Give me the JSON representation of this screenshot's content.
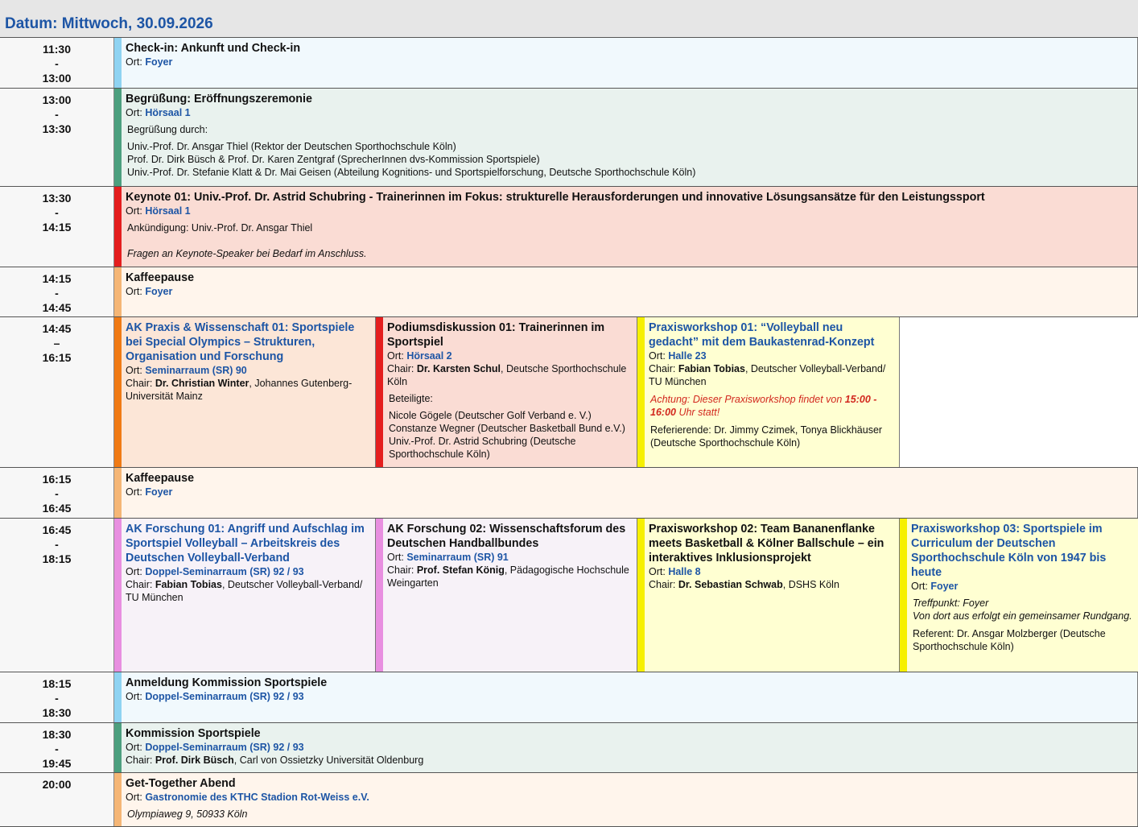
{
  "header": {
    "title": "Datum: Mittwoch, 30.09.2026"
  },
  "rows": [
    {
      "start": "11:30",
      "sep": "-",
      "end": "13:00",
      "cell": {
        "title": "Check-in: Ankunft und Check-in",
        "ort_label": "Ort:",
        "ort": "Foyer"
      }
    },
    {
      "start": "13:00",
      "sep": "-",
      "end": "13:30",
      "cell": {
        "title": "Begrüßung: Eröffnungszeremonie",
        "ort_label": "Ort:",
        "ort": "Hörsaal 1",
        "intro": "Begrüßung durch:",
        "lines": [
          "Univ.-Prof. Dr. Ansgar Thiel (Rektor der Deutschen Sporthochschule Köln)",
          "Prof. Dr. Dirk Büsch & Prof. Dr. Karen Zentgraf (SprecherInnen dvs-Kommission Sportspiele)",
          "Univ.-Prof. Dr. Stefanie Klatt & Dr. Mai Geisen (Abteilung Kognitions- und Sportspielforschung, Deutsche Sporthochschule Köln)"
        ]
      }
    },
    {
      "start": "13:30",
      "sep": "-",
      "end": "14:15",
      "cell": {
        "title": "Keynote 01: Univ.-Prof. Dr. Astrid Schubring - Trainerinnen im Fokus: strukturelle Herausforderungen und innovative Lösungsansätze für den Leistungssport",
        "ort_label": "Ort:",
        "ort": "Hörsaal 1",
        "announce": "Ankündigung: Univ.-Prof. Dr. Ansgar Thiel",
        "note": "Fragen an Keynote-Speaker bei Bedarf im Anschluss."
      }
    },
    {
      "start": "14:15",
      "sep": "-",
      "end": "14:45",
      "cell": {
        "title": "Kaffeepause",
        "ort_label": "Ort:",
        "ort": "Foyer"
      }
    },
    {
      "start": "14:45",
      "sep": "–",
      "end": "16:15",
      "cells": [
        {
          "title": "AK Praxis & Wissenschaft 01: Sportspiele bei Special Olympics – Strukturen, Organisation und Forschung",
          "ort_label": "Ort:",
          "ort": "Seminarraum (SR) 90",
          "chair_label": "Chair:",
          "chair_name": "Dr. Christian Winter",
          "chair_rest": ", Johannes Gutenberg-Universität Mainz"
        },
        {
          "title": "Podiumsdiskussion 01: Trainerinnen im Sportspiel",
          "ort_label": "Ort:",
          "ort": "Hörsaal 2",
          "chair_label": "Chair:",
          "chair_name": "Dr. Karsten Schul",
          "chair_rest": ", Deutsche Sporthochschule Köln",
          "intro": "Beteiligte:",
          "lines": [
            "Nicole Gögele (Deutscher Golf Verband e. V.)",
            "Constanze Wegner (Deutscher Basketball Bund e.V.)",
            "Univ.-Prof. Dr. Astrid Schubring (Deutsche Sporthochschule Köln)"
          ]
        },
        {
          "title": "Praxisworkshop 01: “Volleyball neu gedacht” mit dem Baukastenrad-Konzept",
          "ort_label": "Ort:",
          "ort": "Halle 23",
          "chair_label": "Chair:",
          "chair_name": "Fabian Tobias",
          "chair_rest": ", Deutscher Volleyball-Verband/ TU München",
          "warn_pre": "Achtung: Dieser Praxisworkshop findet von ",
          "warn_time": "15:00 - 16:00",
          "warn_post": " Uhr statt!",
          "ref": "Referierende: Dr. Jimmy Czimek, Tonya Blickhäuser (Deutsche Sporthochschule Köln)"
        }
      ]
    },
    {
      "start": "16:15",
      "sep": "-",
      "end": "16:45",
      "cell": {
        "title": "Kaffeepause",
        "ort_label": "Ort:",
        "ort": "Foyer"
      }
    },
    {
      "start": "16:45",
      "sep": "-",
      "end": "18:15",
      "cells": [
        {
          "title": "AK Forschung 01: Angriff und Aufschlag im Sportspiel Volleyball – Arbeitskreis des Deutschen Volleyball-Verband",
          "ort_label": "Ort:",
          "ort": "Doppel-Seminarraum (SR) 92 / 93",
          "chair_label": "Chair:",
          "chair_name": "Fabian Tobias",
          "chair_rest": ", Deutscher Volleyball-Verband/ TU München"
        },
        {
          "title": "AK Forschung 02: Wissenschaftsforum des Deutschen Handballbundes",
          "ort_label": "Ort:",
          "ort": "Seminarraum (SR) 91",
          "chair_label": "Chair:",
          "chair_name": "Prof. Stefan König",
          "chair_rest": ", Pädagogische Hochschule Weingarten"
        },
        {
          "title": "Praxisworkshop 02: Team Bananenflanke meets Basketball & Kölner Ballschule – ein interaktives Inklusionsprojekt",
          "ort_label": "Ort:",
          "ort": "Halle 8",
          "chair_label": "Chair:",
          "chair_name": "Dr. Sebastian Schwab",
          "chair_rest": ", DSHS Köln"
        },
        {
          "title": "Praxisworkshop 03: Sportspiele im Curriculum der Deutschen Sporthochschule Köln von 1947 bis heute",
          "ort_label": "Ort:",
          "ort": "Foyer",
          "note1": "Treffpunkt: Foyer",
          "note2": "Von dort aus erfolgt ein gemeinsamer Rundgang.",
          "ref": "Referent: Dr. Ansgar Molzberger (Deutsche Sporthochschule Köln)"
        }
      ]
    },
    {
      "start": "18:15",
      "sep": "-",
      "end": "18:30",
      "cell": {
        "title": "Anmeldung Kommission Sportspiele",
        "ort_label": "Ort:",
        "ort": "Doppel-Seminarraum (SR) 92 / 93"
      }
    },
    {
      "start": "18:30",
      "sep": "-",
      "end": "19:45",
      "cell": {
        "title": "Kommission Sportspiele",
        "ort_label": "Ort:",
        "ort": "Doppel-Seminarraum (SR) 92 / 93",
        "chair_label": "Chair:",
        "chair_name": "Prof. Dirk Büsch",
        "chair_rest": ", Carl von Ossietzky Universität Oldenburg"
      }
    },
    {
      "start": "20:00",
      "cell": {
        "title": "Get-Together Abend",
        "ort_label": "Ort:",
        "ort": "Gastronomie des KTHC Stadion Rot-Weiss e.V.",
        "address": "Olympiaweg 9, 50933 Köln"
      }
    }
  ],
  "colors": {
    "blue_bar": "#8fd3f2",
    "blue_bg": "#f1f9fd",
    "green_bar": "#4c9f7e",
    "green_bg": "#e9f2ee",
    "red_bar": "#e41e1e",
    "red_bg": "#fadcd4",
    "peach_bar": "#f5b676",
    "peach_bg": "#fff5ec",
    "orange_bar": "#f07a14",
    "orange_bg": "#fce6d7",
    "yellow_bar": "#f6f000",
    "yellow_bg": "#ffffd2",
    "pink_bar": "#e88fe0",
    "pink_bg": "#f7f2f8",
    "link_blue": "#1d55a5",
    "warn_red": "#d2281e"
  }
}
